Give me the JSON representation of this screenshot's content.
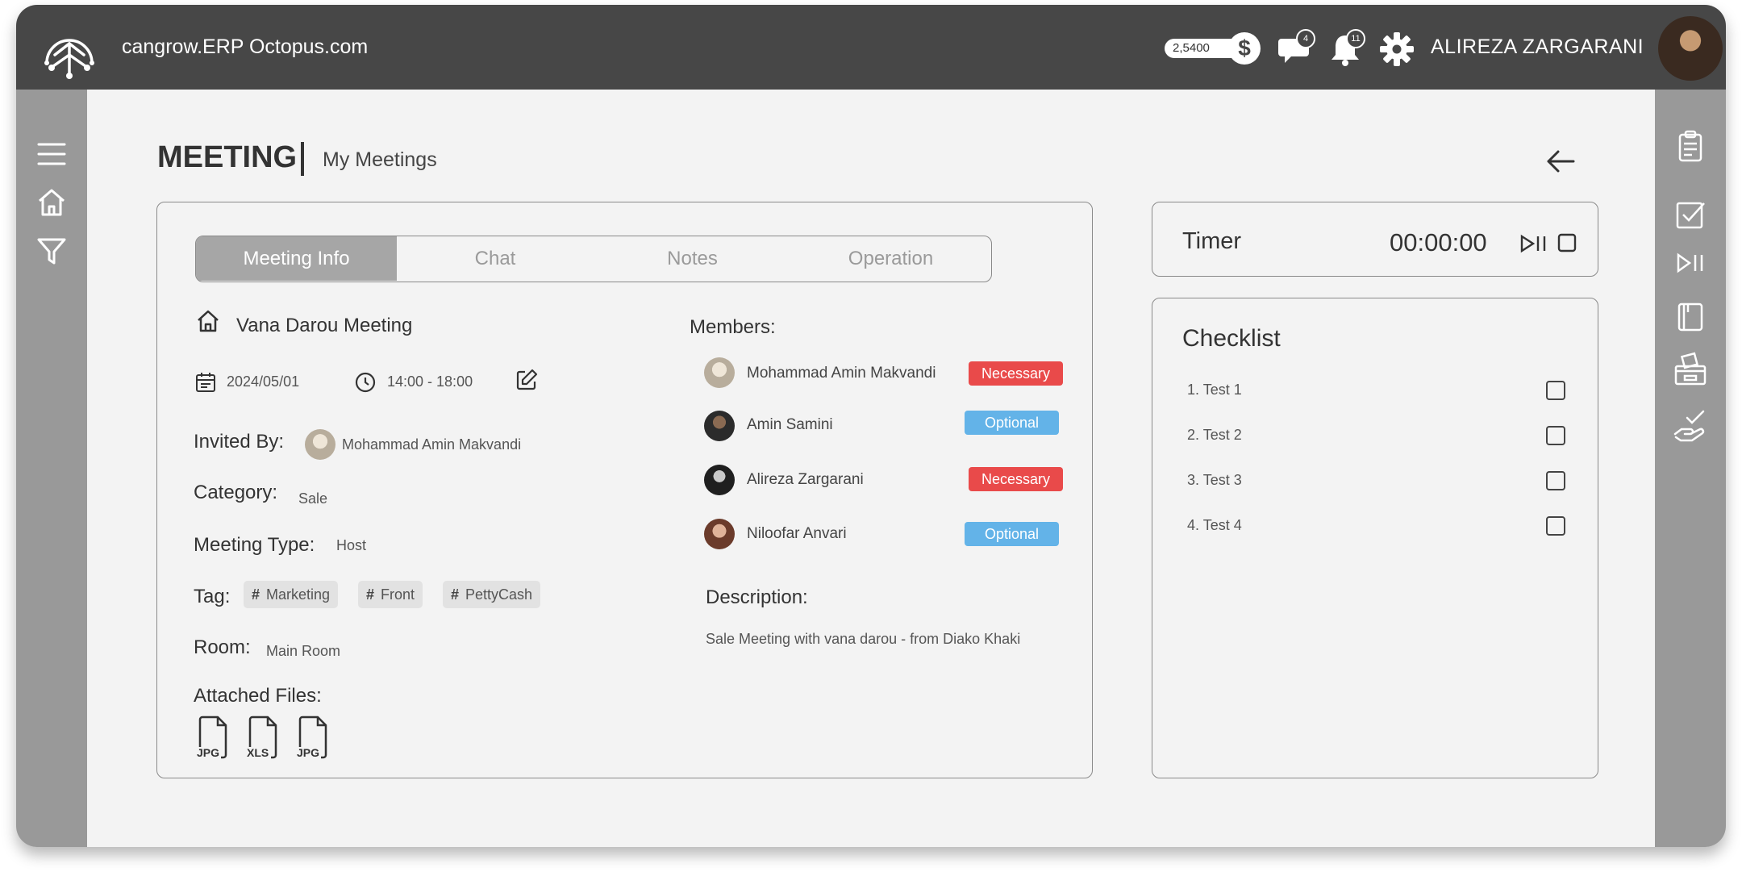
{
  "app": {
    "site": "cangrow.ERP Octopus.com",
    "coins": "2,5400",
    "coin_symbol": "$",
    "chat_badge": "4",
    "notif_badge": "11",
    "user_name": "ALIREZA ZARGARANI"
  },
  "page": {
    "title": "MEETING",
    "subtitle": "My Meetings"
  },
  "tabs": [
    "Meeting Info",
    "Chat",
    "Notes",
    "Operation"
  ],
  "meeting": {
    "name": "Vana Darou Meeting",
    "date": "2024/05/01",
    "time": "14:00 - 18:00",
    "invited_by_label": "Invited By:",
    "invited_by": "Mohammad Amin Makvandi",
    "category_label": "Category:",
    "category": "Sale",
    "type_label": "Meeting Type:",
    "type": "Host",
    "tag_label": "Tag:",
    "tags": [
      "Marketing",
      "Front",
      "PettyCash"
    ],
    "room_label": "Room:",
    "room": "Main Room",
    "files_label": "Attached Files:",
    "files": [
      "JPG",
      "XLS",
      "JPG"
    ]
  },
  "members": {
    "label": "Members:",
    "list": [
      {
        "name": "Mohammad Amin Makvandi",
        "role": "Necessary"
      },
      {
        "name": "Amin Samini",
        "role": "Optional"
      },
      {
        "name": "Alireza Zargarani",
        "role": "Necessary"
      },
      {
        "name": "Niloofar Anvari",
        "role": "Optional"
      }
    ]
  },
  "description": {
    "label": "Description:",
    "text": "Sale Meeting with vana darou - from Diako Khaki"
  },
  "timer": {
    "label": "Timer",
    "value": "00:00:00"
  },
  "checklist": {
    "title": "Checklist",
    "items": [
      "1. Test 1",
      "2. Test 2",
      "3. Test 3",
      "4. Test 4"
    ]
  },
  "colors": {
    "topbar": "#474747",
    "sidebar": "#999999",
    "necessary": "#e94a4a",
    "optional": "#63b3e8"
  },
  "icons": {
    "top": [
      "octopus-logo-icon",
      "dollar-coin-icon",
      "chat-icon",
      "bell-icon",
      "gear-icon"
    ],
    "left": [
      "menu-icon",
      "home-icon",
      "filter-icon"
    ],
    "right": [
      "clipboard-icon",
      "checkbox-icon",
      "play-pause-icon",
      "notebook-icon",
      "ballot-box-icon",
      "hand-check-icon"
    ]
  }
}
